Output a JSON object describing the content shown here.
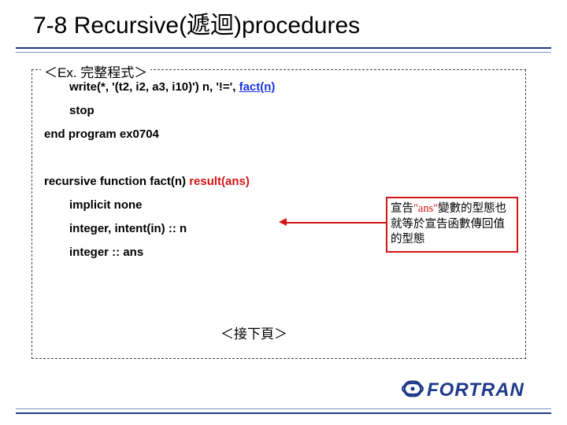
{
  "title": "7-8 Recursive(遞迴)procedures",
  "legend": {
    "prefix": "＜Ex. ",
    "cjk": "完整程式",
    "suffix": "＞"
  },
  "code": {
    "l1a": "write(*, '(t2, i2, a3, i10)') n, '!=', ",
    "l1b": "fact(n)",
    "l2": "stop",
    "l3": "end program ex0704",
    "l4a": "recursive function fact(n) ",
    "l4b": "result(ans)",
    "l5": "implicit none",
    "l6": "integer, intent(in) :: n",
    "l7": "integer :: ans"
  },
  "annotation": {
    "p1a": "宣告",
    "p1b": "\"ans\"",
    "p1c": "變數的型態也就等於宣告函數傳回值的型態"
  },
  "cont": "＜接下頁＞",
  "logo_text": "FORTRAN"
}
